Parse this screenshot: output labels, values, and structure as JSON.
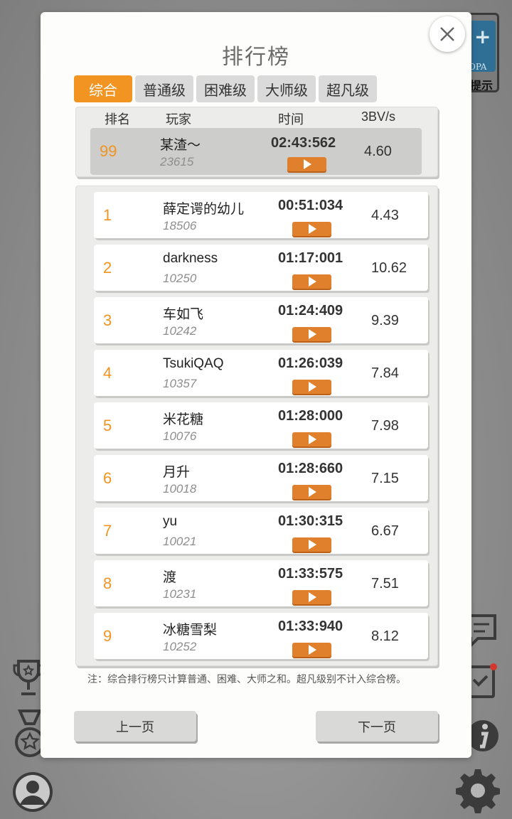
{
  "background": {
    "hint_card": {
      "plus": "+",
      "opa_text": "OPA",
      "hint_text": "提示"
    }
  },
  "dialog": {
    "title": "排行榜",
    "tabs": [
      {
        "label": "综合",
        "active": true
      },
      {
        "label": "普通级",
        "active": false
      },
      {
        "label": "困难级",
        "active": false
      },
      {
        "label": "大师级",
        "active": false
      },
      {
        "label": "超凡级",
        "active": false
      }
    ],
    "columns": {
      "rank": "排名",
      "player": "玩家",
      "time": "时间",
      "score": "3BV/s"
    },
    "my_entry": {
      "rank": "99",
      "name": "某渣～",
      "id": "23615",
      "time": "02:43:562",
      "score": "4.60"
    },
    "entries": [
      {
        "rank": "1",
        "name": "薛定谔的幼儿",
        "id": "18506",
        "time": "00:51:034",
        "score": "4.43"
      },
      {
        "rank": "2",
        "name": "darkness",
        "id": "10250",
        "time": "01:17:001",
        "score": "10.62"
      },
      {
        "rank": "3",
        "name": "车如飞",
        "id": "10242",
        "time": "01:24:409",
        "score": "9.39"
      },
      {
        "rank": "4",
        "name": "TsukiQAQ",
        "id": "10357",
        "time": "01:26:039",
        "score": "7.84"
      },
      {
        "rank": "5",
        "name": "米花糖",
        "id": "10076",
        "time": "01:28:000",
        "score": "7.98"
      },
      {
        "rank": "6",
        "name": "月升",
        "id": "10018",
        "time": "01:28:660",
        "score": "7.15"
      },
      {
        "rank": "7",
        "name": "yu",
        "id": "10021",
        "time": "01:30:315",
        "score": "6.67"
      },
      {
        "rank": "8",
        "name": "渡",
        "id": "10231",
        "time": "01:33:575",
        "score": "7.51"
      },
      {
        "rank": "9",
        "name": "冰糖雪梨",
        "id": "10252",
        "time": "01:33:940",
        "score": "8.12"
      }
    ],
    "note": "注：综合排行榜只计算普通、困难、大师之和。超凡级别不计入综合榜。",
    "prev_label": "上一页",
    "next_label": "下一页"
  },
  "colors": {
    "accent": "#f19422",
    "play_button": "#e07f2c",
    "panel": "#ececea"
  },
  "icons": [
    "close-icon",
    "play-icon",
    "trophy-icon",
    "medal-icon",
    "avatar-icon",
    "message-icon",
    "checklist-icon",
    "info-icon",
    "gear-icon"
  ]
}
